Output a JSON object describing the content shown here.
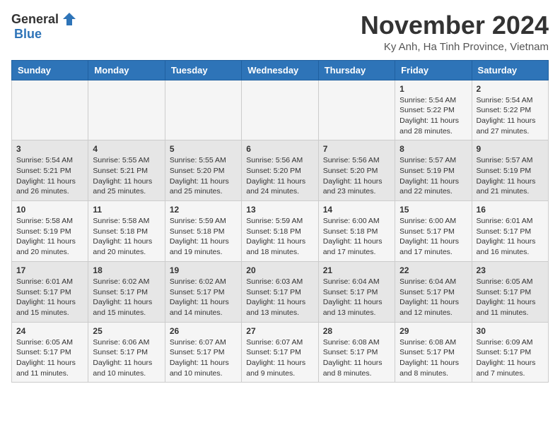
{
  "header": {
    "logo_general": "General",
    "logo_blue": "Blue",
    "month_title": "November 2024",
    "location": "Ky Anh, Ha Tinh Province, Vietnam"
  },
  "weekdays": [
    "Sunday",
    "Monday",
    "Tuesday",
    "Wednesday",
    "Thursday",
    "Friday",
    "Saturday"
  ],
  "weeks": [
    {
      "days": [
        {
          "date": "",
          "info": ""
        },
        {
          "date": "",
          "info": ""
        },
        {
          "date": "",
          "info": ""
        },
        {
          "date": "",
          "info": ""
        },
        {
          "date": "",
          "info": ""
        },
        {
          "date": "1",
          "info": "Sunrise: 5:54 AM\nSunset: 5:22 PM\nDaylight: 11 hours\nand 28 minutes."
        },
        {
          "date": "2",
          "info": "Sunrise: 5:54 AM\nSunset: 5:22 PM\nDaylight: 11 hours\nand 27 minutes."
        }
      ]
    },
    {
      "days": [
        {
          "date": "3",
          "info": "Sunrise: 5:54 AM\nSunset: 5:21 PM\nDaylight: 11 hours\nand 26 minutes."
        },
        {
          "date": "4",
          "info": "Sunrise: 5:55 AM\nSunset: 5:21 PM\nDaylight: 11 hours\nand 25 minutes."
        },
        {
          "date": "5",
          "info": "Sunrise: 5:55 AM\nSunset: 5:20 PM\nDaylight: 11 hours\nand 25 minutes."
        },
        {
          "date": "6",
          "info": "Sunrise: 5:56 AM\nSunset: 5:20 PM\nDaylight: 11 hours\nand 24 minutes."
        },
        {
          "date": "7",
          "info": "Sunrise: 5:56 AM\nSunset: 5:20 PM\nDaylight: 11 hours\nand 23 minutes."
        },
        {
          "date": "8",
          "info": "Sunrise: 5:57 AM\nSunset: 5:19 PM\nDaylight: 11 hours\nand 22 minutes."
        },
        {
          "date": "9",
          "info": "Sunrise: 5:57 AM\nSunset: 5:19 PM\nDaylight: 11 hours\nand 21 minutes."
        }
      ]
    },
    {
      "days": [
        {
          "date": "10",
          "info": "Sunrise: 5:58 AM\nSunset: 5:19 PM\nDaylight: 11 hours\nand 20 minutes."
        },
        {
          "date": "11",
          "info": "Sunrise: 5:58 AM\nSunset: 5:18 PM\nDaylight: 11 hours\nand 20 minutes."
        },
        {
          "date": "12",
          "info": "Sunrise: 5:59 AM\nSunset: 5:18 PM\nDaylight: 11 hours\nand 19 minutes."
        },
        {
          "date": "13",
          "info": "Sunrise: 5:59 AM\nSunset: 5:18 PM\nDaylight: 11 hours\nand 18 minutes."
        },
        {
          "date": "14",
          "info": "Sunrise: 6:00 AM\nSunset: 5:18 PM\nDaylight: 11 hours\nand 17 minutes."
        },
        {
          "date": "15",
          "info": "Sunrise: 6:00 AM\nSunset: 5:17 PM\nDaylight: 11 hours\nand 17 minutes."
        },
        {
          "date": "16",
          "info": "Sunrise: 6:01 AM\nSunset: 5:17 PM\nDaylight: 11 hours\nand 16 minutes."
        }
      ]
    },
    {
      "days": [
        {
          "date": "17",
          "info": "Sunrise: 6:01 AM\nSunset: 5:17 PM\nDaylight: 11 hours\nand 15 minutes."
        },
        {
          "date": "18",
          "info": "Sunrise: 6:02 AM\nSunset: 5:17 PM\nDaylight: 11 hours\nand 15 minutes."
        },
        {
          "date": "19",
          "info": "Sunrise: 6:02 AM\nSunset: 5:17 PM\nDaylight: 11 hours\nand 14 minutes."
        },
        {
          "date": "20",
          "info": "Sunrise: 6:03 AM\nSunset: 5:17 PM\nDaylight: 11 hours\nand 13 minutes."
        },
        {
          "date": "21",
          "info": "Sunrise: 6:04 AM\nSunset: 5:17 PM\nDaylight: 11 hours\nand 13 minutes."
        },
        {
          "date": "22",
          "info": "Sunrise: 6:04 AM\nSunset: 5:17 PM\nDaylight: 11 hours\nand 12 minutes."
        },
        {
          "date": "23",
          "info": "Sunrise: 6:05 AM\nSunset: 5:17 PM\nDaylight: 11 hours\nand 11 minutes."
        }
      ]
    },
    {
      "days": [
        {
          "date": "24",
          "info": "Sunrise: 6:05 AM\nSunset: 5:17 PM\nDaylight: 11 hours\nand 11 minutes."
        },
        {
          "date": "25",
          "info": "Sunrise: 6:06 AM\nSunset: 5:17 PM\nDaylight: 11 hours\nand 10 minutes."
        },
        {
          "date": "26",
          "info": "Sunrise: 6:07 AM\nSunset: 5:17 PM\nDaylight: 11 hours\nand 10 minutes."
        },
        {
          "date": "27",
          "info": "Sunrise: 6:07 AM\nSunset: 5:17 PM\nDaylight: 11 hours\nand 9 minutes."
        },
        {
          "date": "28",
          "info": "Sunrise: 6:08 AM\nSunset: 5:17 PM\nDaylight: 11 hours\nand 8 minutes."
        },
        {
          "date": "29",
          "info": "Sunrise: 6:08 AM\nSunset: 5:17 PM\nDaylight: 11 hours\nand 8 minutes."
        },
        {
          "date": "30",
          "info": "Sunrise: 6:09 AM\nSunset: 5:17 PM\nDaylight: 11 hours\nand 7 minutes."
        }
      ]
    }
  ]
}
